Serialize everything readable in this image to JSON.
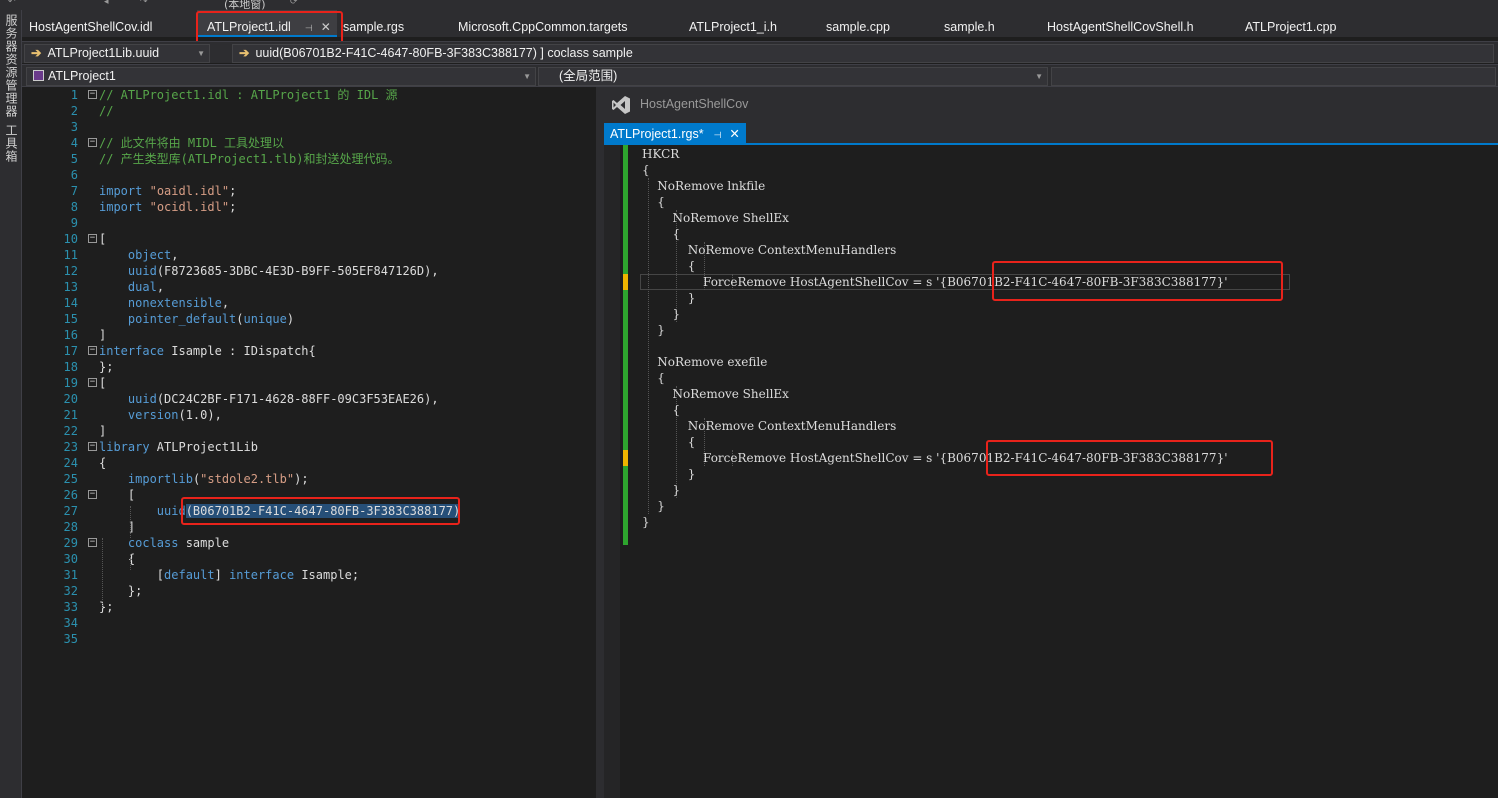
{
  "toolbar": {
    "partial_label": "(本地窗)"
  },
  "left_strip": {
    "items": [
      "服务器资源管理器",
      "工具箱"
    ]
  },
  "tabs": [
    {
      "label": "HostAgentShellCov.idl"
    },
    {
      "label": "ATLProject1.idl"
    },
    {
      "label": "sample.rgs"
    },
    {
      "label": "Microsoft.CppCommon.targets"
    },
    {
      "label": "ATLProject1_i.h"
    },
    {
      "label": "sample.cpp"
    },
    {
      "label": "sample.h"
    },
    {
      "label": "HostAgentShellCovShell.h"
    },
    {
      "label": "ATLProject1.cpp"
    }
  ],
  "nav": {
    "scope1": "ATLProject1Lib.uuid",
    "member1": "uuid(B06701B2-F41C-4647-80FB-3F383C388177) ] coclass sample",
    "project": "ATLProject1",
    "scope2": "(全局范围)"
  },
  "left_editor": {
    "lines": [
      "// ATLProject1.idl : ATLProject1 的 IDL 源",
      "//",
      "",
      "// 此文件将由 MIDL 工具处理以",
      "// 产生类型库(ATLProject1.tlb)和封送处理代码。",
      "",
      "import \"oaidl.idl\";",
      "import \"ocidl.idl\";",
      "",
      "[",
      "    object,",
      "    uuid(F8723685-3DBC-4E3D-B9FF-505EF847126D),",
      "    dual,",
      "    nonextensible,",
      "    pointer_default(unique)",
      "]",
      "interface Isample : IDispatch{",
      "};",
      "[",
      "    uuid(DC24C2BF-F171-4628-88FF-09C3F53EAE26),",
      "    version(1.0),",
      "]",
      "library ATLProject1Lib",
      "{",
      "    importlib(\"stdole2.tlb\");",
      "    [",
      "        uuid(B06701B2-F41C-4647-80FB-3F383C388177)",
      "    ]",
      "    coclass sample",
      "    {",
      "        [default] interface Isample;",
      "    };",
      "};",
      "",
      ""
    ],
    "line_numbers": [
      "1",
      "2",
      "3",
      "4",
      "5",
      "6",
      "7",
      "8",
      "9",
      "10",
      "11",
      "12",
      "13",
      "14",
      "15",
      "16",
      "17",
      "18",
      "19",
      "20",
      "21",
      "22",
      "23",
      "24",
      "25",
      "26",
      "27",
      "28",
      "29",
      "30",
      "31",
      "32",
      "33",
      "34",
      "35"
    ]
  },
  "right_pane": {
    "title": "HostAgentShellCov",
    "tab_label": "ATLProject1.rgs*",
    "lines": [
      "HKCR",
      "{",
      "    NoRemove lnkfile",
      "    {",
      "        NoRemove ShellEx",
      "        {",
      "            NoRemove ContextMenuHandlers",
      "            {",
      "                ForceRemove HostAgentShellCov = s '{B06701B2-F41C-4647-80FB-3F383C388177}'",
      "            }",
      "        }",
      "    }",
      "",
      "    NoRemove exefile",
      "    {",
      "        NoRemove ShellEx",
      "        {",
      "            NoRemove ContextMenuHandlers",
      "            {",
      "                ForceRemove HostAgentShellCov = s '{B06701B2-F41C-4647-80FB-3F383C388177}'",
      "            }",
      "        }",
      "    }",
      "}"
    ]
  },
  "colors": {
    "accent": "#007acc",
    "highlight_box": "#e8231b",
    "comment": "#57a64a",
    "keyword": "#569cd6",
    "string": "#d69d85",
    "line_number": "#2b91af",
    "change_saved": "#2ea52e",
    "change_unsaved": "#efb500"
  }
}
